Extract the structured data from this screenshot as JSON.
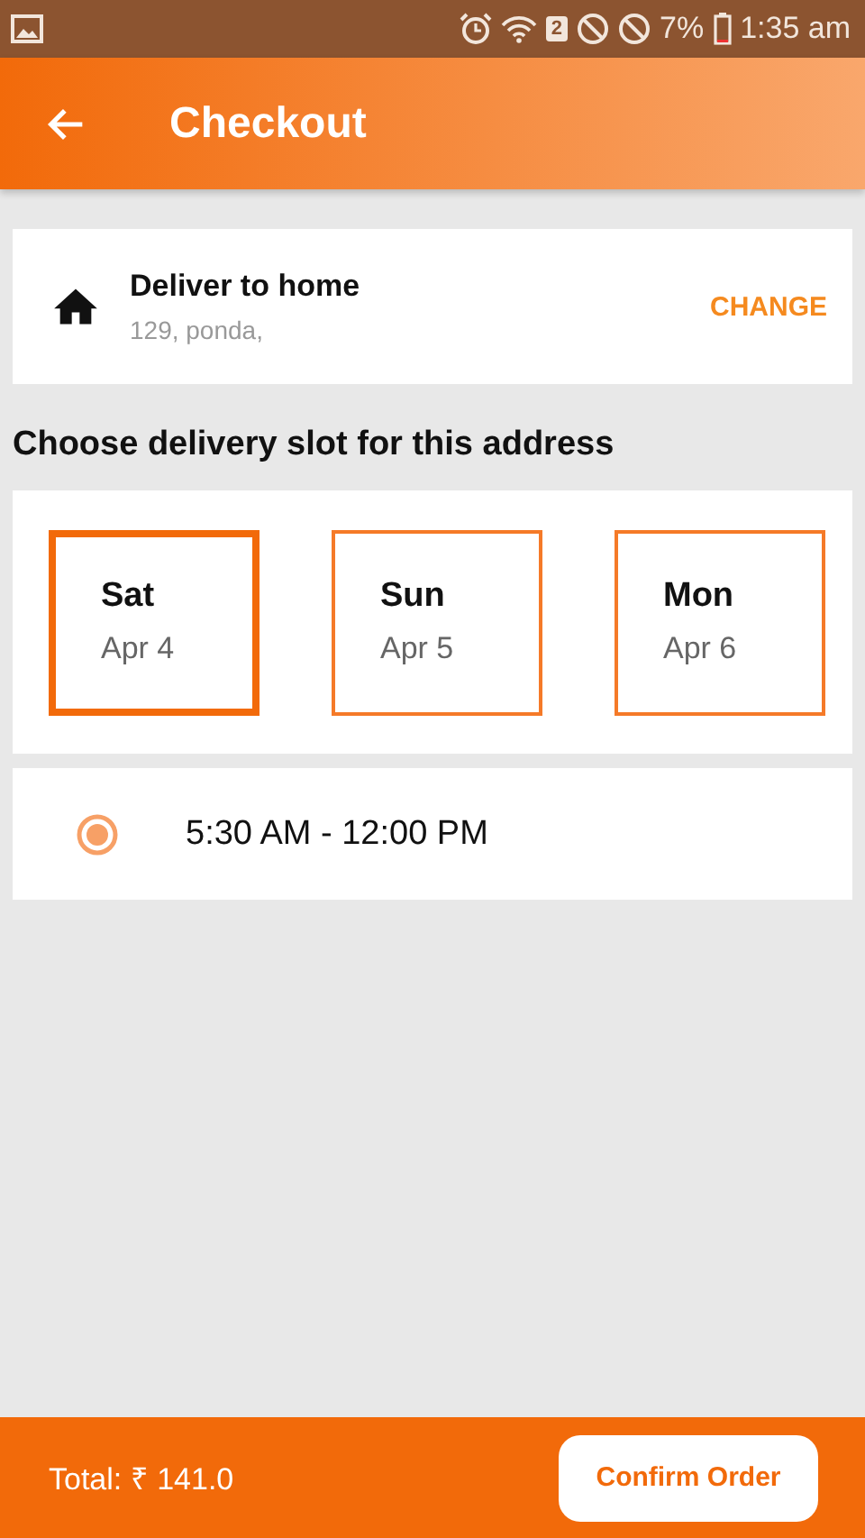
{
  "status_bar": {
    "sim_slot": "2",
    "battery": "7%",
    "time": "1:35 am"
  },
  "app_bar": {
    "title": "Checkout"
  },
  "address": {
    "title": "Deliver to home",
    "line": "129, ponda,",
    "action": "CHANGE"
  },
  "slot_heading": "Choose delivery slot for this address",
  "dates": [
    {
      "day": "Sat",
      "date": "Apr 4",
      "selected": true
    },
    {
      "day": "Sun",
      "date": "Apr 5",
      "selected": false
    },
    {
      "day": "Mon",
      "date": "Apr 6",
      "selected": false
    }
  ],
  "times": [
    {
      "label": "5:30 AM - 12:00 PM",
      "selected": true
    }
  ],
  "footer": {
    "total": "Total: ₹ 141.0",
    "button": "Confirm Order"
  }
}
